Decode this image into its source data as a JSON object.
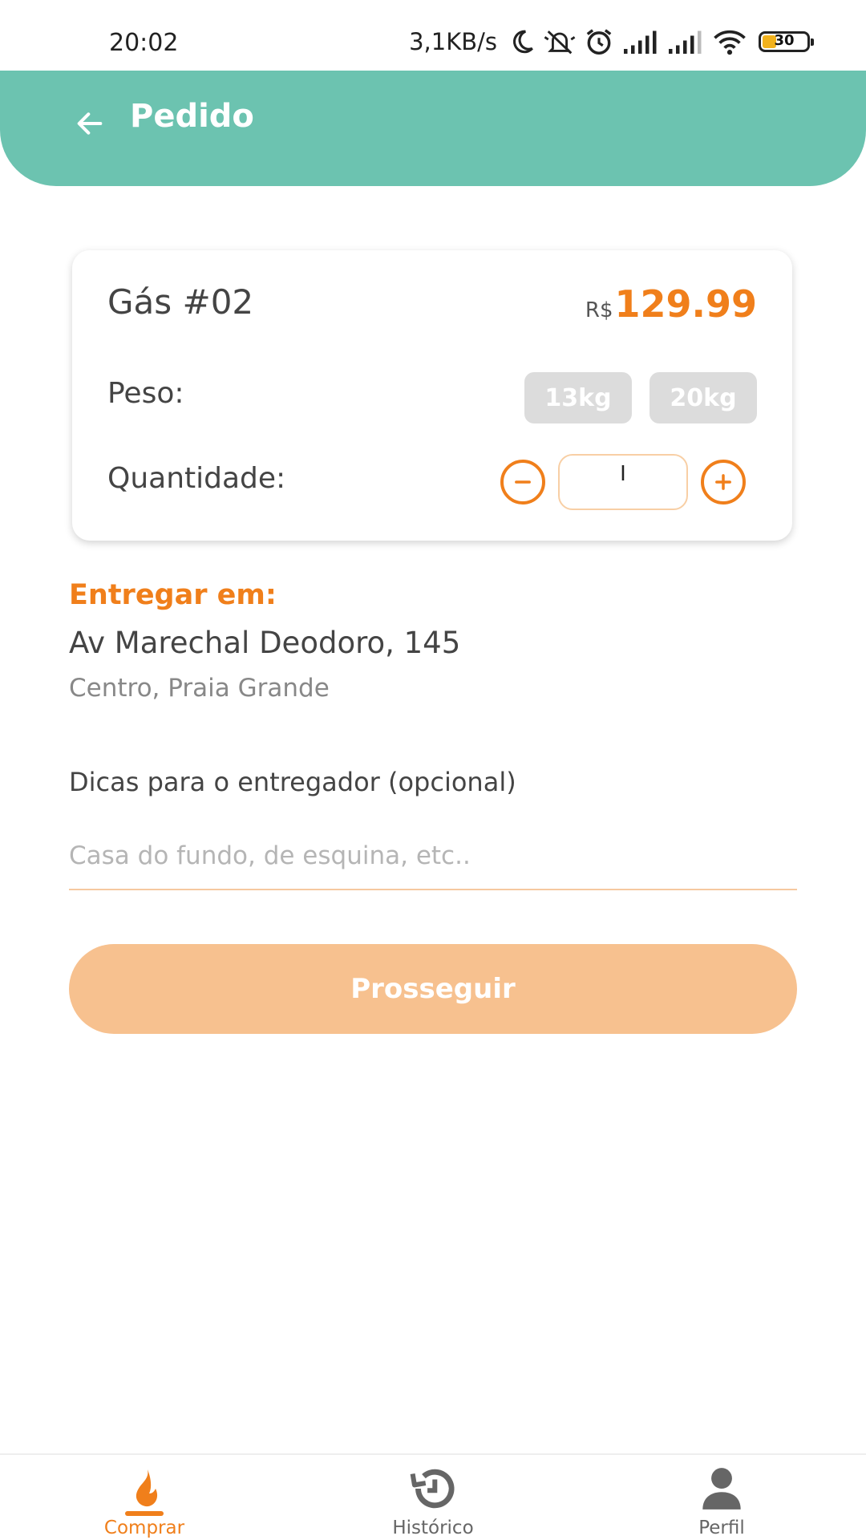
{
  "status_bar": {
    "time": "20:02",
    "speed": "3,1KB/s",
    "battery_percent": 30,
    "battery_label": "30",
    "icons": [
      "moon-icon",
      "muted-bell-icon",
      "alarm-icon",
      "signal-icon",
      "signal-icon",
      "wifi-icon",
      "battery-icon"
    ]
  },
  "header": {
    "title": "Pedido",
    "back_icon": "arrow-left-icon"
  },
  "product": {
    "name": "Gás #02",
    "currency": "R$",
    "price": "129.99",
    "weight_label": "Peso:",
    "weight_options": [
      "13kg",
      "20kg"
    ],
    "quantity_label": "Quantidade:",
    "quantity_value": "I"
  },
  "delivery": {
    "label": "Entregar em:",
    "address_line1": "Av Marechal Deodoro, 145",
    "address_line2": "Centro, Praia Grande"
  },
  "tips": {
    "label": "Dicas para o entregador (opcional)",
    "placeholder": "Casa do fundo, de esquina, etc..",
    "value": ""
  },
  "actions": {
    "proceed_label": "Prosseguir"
  },
  "bottom_nav": {
    "items": [
      {
        "label": "Comprar",
        "icon": "flame-icon",
        "active": true
      },
      {
        "label": "Histórico",
        "icon": "history-icon",
        "active": false
      },
      {
        "label": "Perfil",
        "icon": "user-icon",
        "active": false
      }
    ]
  },
  "colors": {
    "header_bg": "#6cc3b0",
    "accent": "#f07f1b",
    "button_disabled": "#f7c18f",
    "chip_bg": "#dcdcdc"
  }
}
